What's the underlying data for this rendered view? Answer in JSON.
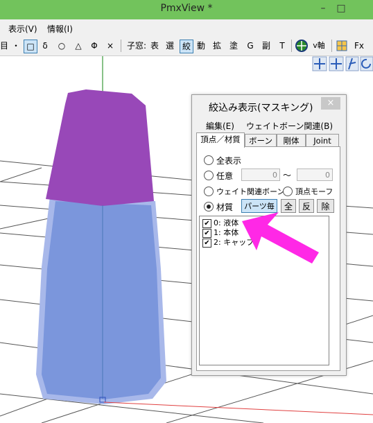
{
  "window": {
    "title": "PmxView *",
    "minimize": "–",
    "maximize": "□"
  },
  "menubar": {
    "items": [
      "表示(V)",
      "情報(I)"
    ]
  },
  "toolbar": {
    "left_items": [
      "目:",
      "・",
      "□",
      "δ",
      "○",
      "△",
      "Φ",
      "×"
    ],
    "child_label": "子窓:",
    "child_items": [
      "表",
      "選",
      "絞",
      "動",
      "拡",
      "塗",
      "G",
      "副",
      "T"
    ],
    "extra_items": [
      "v軸",
      "Fx"
    ]
  },
  "dialog": {
    "title": "絞込み表示(マスキング)",
    "close_label": "×",
    "menu": [
      "編集(E)",
      "ウェイトボーン関連(B)"
    ],
    "tabs": [
      "頂点／材質",
      "ボーン",
      "剛体",
      "Joint"
    ],
    "options": {
      "all": "全表示",
      "range": "任意",
      "range_from": "0",
      "range_tilde": "〜",
      "range_to": "0",
      "weight_bone": "ウェイト関連ボーン",
      "vertex_morph": "頂点モーフ",
      "material": "材質"
    },
    "buttons": {
      "parts": "パーツ毎",
      "all": "全",
      "invert": "反",
      "remove": "除"
    },
    "materials": [
      {
        "label": "0: 液体",
        "checked": true
      },
      {
        "label": "1: 本体",
        "checked": true
      },
      {
        "label": "2: キャップ",
        "checked": true
      }
    ]
  },
  "colors": {
    "titlebar": "#72c35c",
    "cap": "#9848b8",
    "body": "#7b96dc",
    "arrow": "#ff28e6"
  }
}
